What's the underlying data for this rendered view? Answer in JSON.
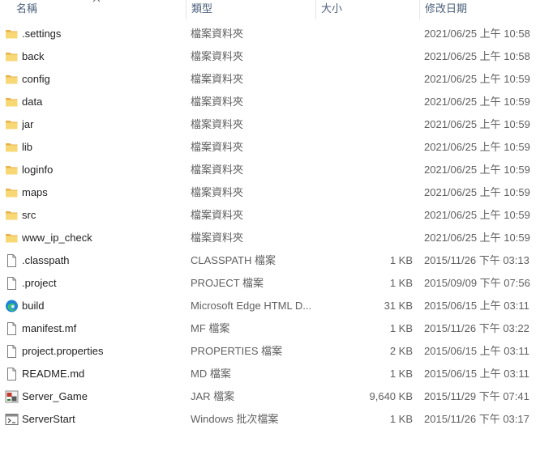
{
  "header": {
    "name": "名稱",
    "type": "類型",
    "size": "大小",
    "modified": "修改日期"
  },
  "rows": [
    {
      "name": ".settings",
      "type": "檔案資料夾",
      "size": "",
      "date": "2021/06/25 上午 10:58",
      "icon": "folder-icon"
    },
    {
      "name": "back",
      "type": "檔案資料夾",
      "size": "",
      "date": "2021/06/25 上午 10:58",
      "icon": "folder-icon"
    },
    {
      "name": "config",
      "type": "檔案資料夾",
      "size": "",
      "date": "2021/06/25 上午 10:59",
      "icon": "folder-icon"
    },
    {
      "name": "data",
      "type": "檔案資料夾",
      "size": "",
      "date": "2021/06/25 上午 10:59",
      "icon": "folder-icon"
    },
    {
      "name": "jar",
      "type": "檔案資料夾",
      "size": "",
      "date": "2021/06/25 上午 10:59",
      "icon": "folder-icon"
    },
    {
      "name": "lib",
      "type": "檔案資料夾",
      "size": "",
      "date": "2021/06/25 上午 10:59",
      "icon": "folder-icon"
    },
    {
      "name": "loginfo",
      "type": "檔案資料夾",
      "size": "",
      "date": "2021/06/25 上午 10:59",
      "icon": "folder-icon"
    },
    {
      "name": "maps",
      "type": "檔案資料夾",
      "size": "",
      "date": "2021/06/25 上午 10:59",
      "icon": "folder-icon"
    },
    {
      "name": "src",
      "type": "檔案資料夾",
      "size": "",
      "date": "2021/06/25 上午 10:59",
      "icon": "folder-icon"
    },
    {
      "name": "www_ip_check",
      "type": "檔案資料夾",
      "size": "",
      "date": "2021/06/25 上午 10:59",
      "icon": "folder-icon"
    },
    {
      "name": ".classpath",
      "type": "CLASSPATH 檔案",
      "size": "1 KB",
      "date": "2015/11/26 下午 03:13",
      "icon": "file-icon"
    },
    {
      "name": ".project",
      "type": "PROJECT 檔案",
      "size": "1 KB",
      "date": "2015/09/09 下午 07:56",
      "icon": "file-icon"
    },
    {
      "name": "build",
      "type": "Microsoft Edge HTML D...",
      "size": "31 KB",
      "date": "2015/06/15 上午 03:11",
      "icon": "edge-icon"
    },
    {
      "name": "manifest.mf",
      "type": "MF 檔案",
      "size": "1 KB",
      "date": "2015/11/26 下午 03:22",
      "icon": "file-icon"
    },
    {
      "name": "project.properties",
      "type": "PROPERTIES 檔案",
      "size": "2 KB",
      "date": "2015/06/15 上午 03:11",
      "icon": "file-icon"
    },
    {
      "name": "README.md",
      "type": "MD 檔案",
      "size": "1 KB",
      "date": "2015/06/15 上午 03:11",
      "icon": "file-icon"
    },
    {
      "name": "Server_Game",
      "type": "JAR 檔案",
      "size": "9,640 KB",
      "date": "2015/11/29 下午 07:41",
      "icon": "jar-icon"
    },
    {
      "name": "ServerStart",
      "type": "Windows 批次檔案",
      "size": "1 KB",
      "date": "2015/11/26 下午 03:17",
      "icon": "batch-icon"
    }
  ]
}
